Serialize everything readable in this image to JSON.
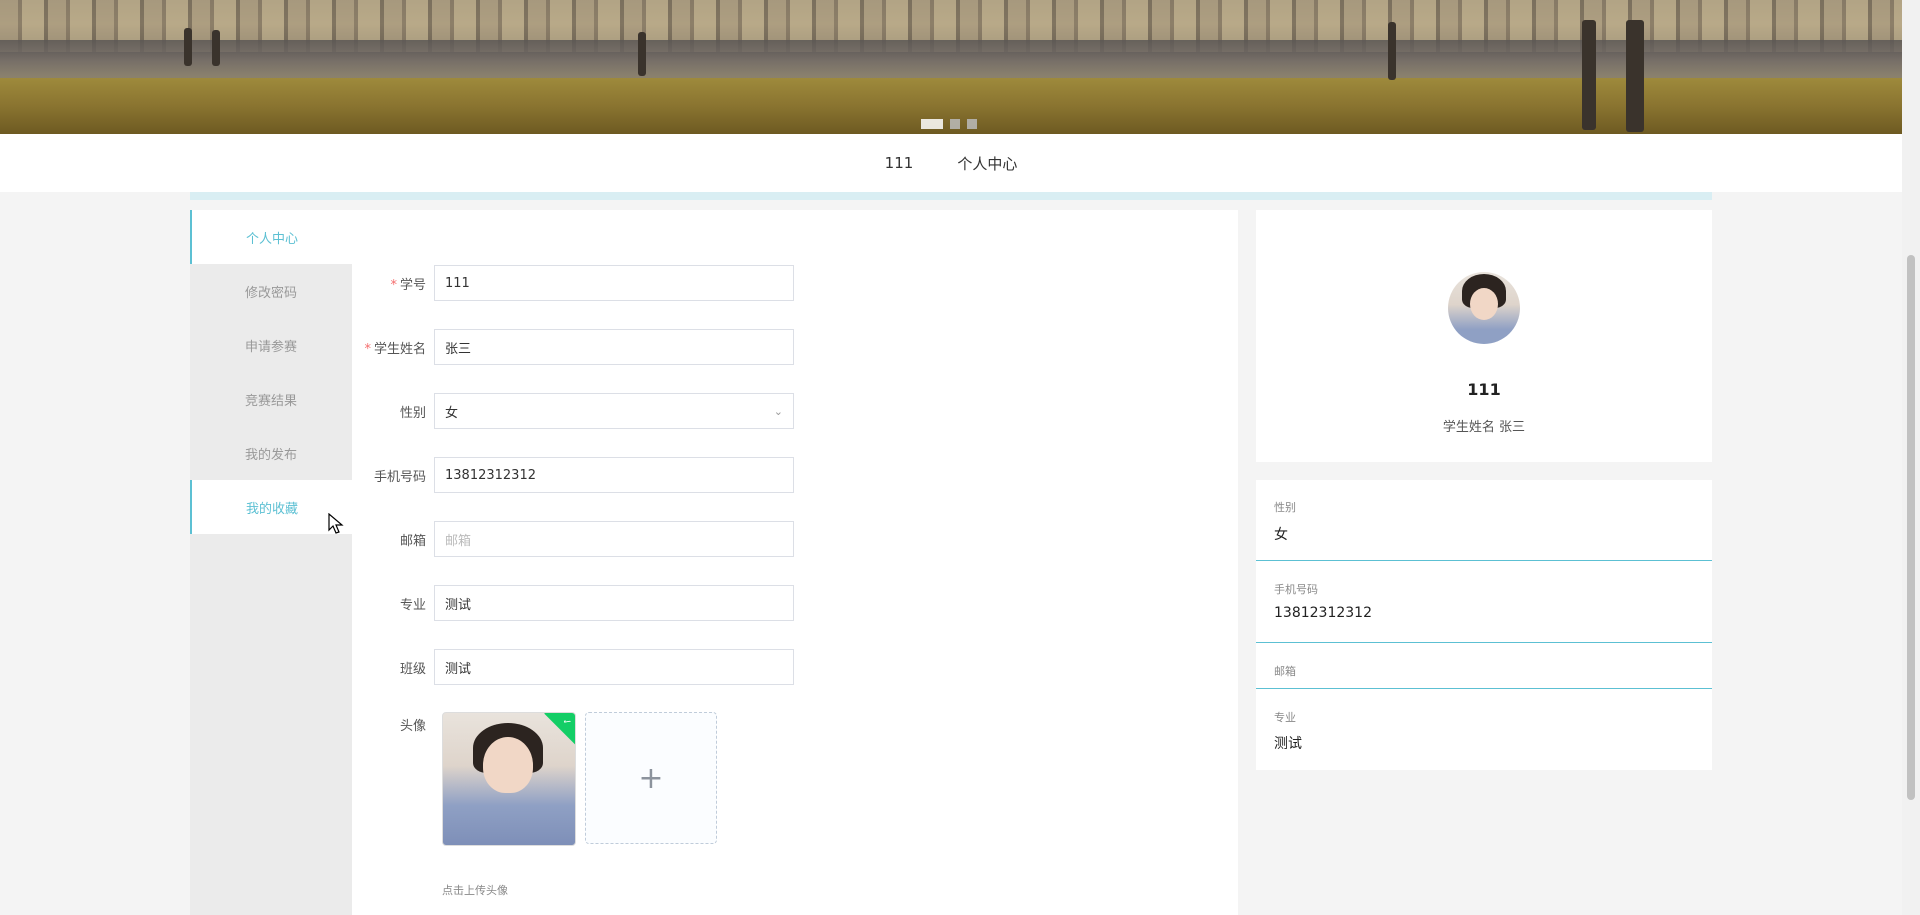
{
  "banner": {
    "active_slide": 1,
    "slide_count": 3
  },
  "nav": {
    "items": [
      "111",
      "个人中心"
    ]
  },
  "sidebar": {
    "items": [
      {
        "label": "个人中心",
        "active": true
      },
      {
        "label": "修改密码",
        "active": false
      },
      {
        "label": "申请参赛",
        "active": false
      },
      {
        "label": "竞赛结果",
        "active": false
      },
      {
        "label": "我的发布",
        "active": false
      },
      {
        "label": "我的收藏",
        "active": true
      }
    ]
  },
  "form": {
    "student_id": {
      "label": "学号",
      "required": true,
      "value": "111"
    },
    "student_name": {
      "label": "学生姓名",
      "required": true,
      "value": "张三"
    },
    "gender": {
      "label": "性别",
      "value": "女"
    },
    "phone": {
      "label": "手机号码",
      "value": "13812312312"
    },
    "email": {
      "label": "邮箱",
      "value": "",
      "placeholder": "邮箱"
    },
    "major": {
      "label": "专业",
      "value": "测试"
    },
    "class": {
      "label": "班级",
      "value": "测试"
    },
    "avatar": {
      "label": "头像",
      "hint": "点击上传头像",
      "upload_symbol": "+"
    }
  },
  "profile": {
    "id": "111",
    "name_line": "学生姓名 张三"
  },
  "info": [
    {
      "key": "性别",
      "value": "女"
    },
    {
      "key": "手机号码",
      "value": "13812312312"
    },
    {
      "key": "邮箱",
      "value": ""
    },
    {
      "key": "专业",
      "value": "测试"
    }
  ],
  "colors": {
    "accent": "#5cc0d3",
    "required": "#f56c6c",
    "success": "#13ce66"
  },
  "icons": [
    "chevron-down-icon",
    "plus-icon",
    "check-icon",
    "cursor-icon"
  ]
}
